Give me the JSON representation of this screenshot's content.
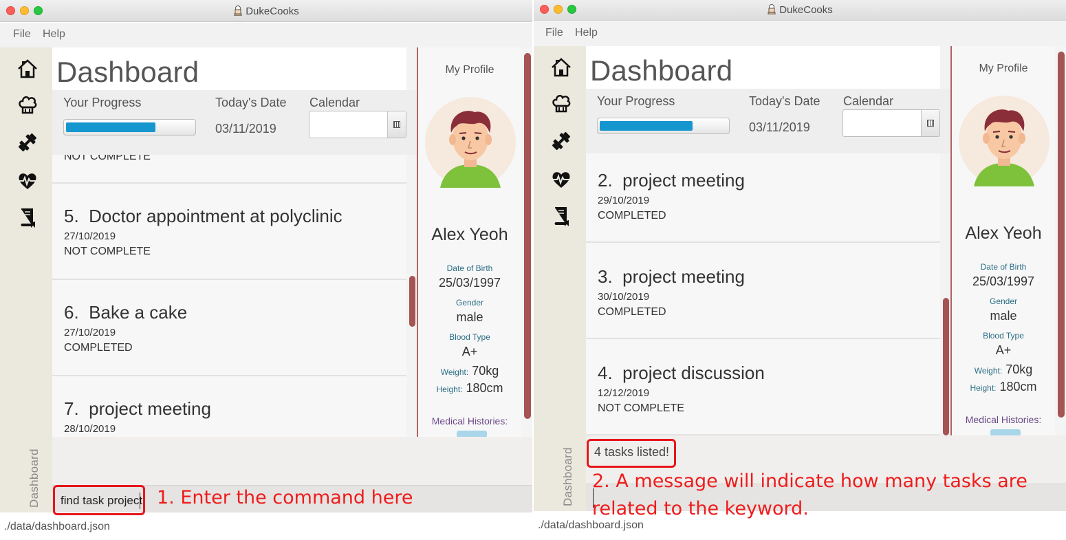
{
  "app": {
    "title": "DukeCooks"
  },
  "menu": {
    "file": "File",
    "help": "Help"
  },
  "sidebar": {
    "vertical_label": "Dashboard"
  },
  "dashboard": {
    "title": "Dashboard",
    "progress_label": "Your Progress",
    "date_label": "Today's Date",
    "calendar_label": "Calendar",
    "date_value": "03/11/2019"
  },
  "left": {
    "progress_fraction": 0.7,
    "partial_status": "NOT COMPLETE",
    "tasks": [
      {
        "index": "5.",
        "title": "Doctor appointment at polyclinic",
        "date": "27/10/2019",
        "status": "NOT COMPLETE"
      },
      {
        "index": "6.",
        "title": "Bake a cake",
        "date": "27/10/2019",
        "status": "COMPLETED"
      },
      {
        "index": "7.",
        "title": "project meeting",
        "date": "28/10/2019",
        "status": ""
      }
    ],
    "command": "find task project",
    "result": ""
  },
  "right": {
    "progress_fraction": 0.73,
    "tasks": [
      {
        "index": "2.",
        "title": "project meeting",
        "date": "29/10/2019",
        "status": "COMPLETED"
      },
      {
        "index": "3.",
        "title": "project meeting",
        "date": "30/10/2019",
        "status": "COMPLETED"
      },
      {
        "index": "4.",
        "title": "project discussion",
        "date": "12/12/2019",
        "status": "NOT COMPLETE"
      }
    ],
    "command": "",
    "result": "4 tasks listed!"
  },
  "profile": {
    "heading": "My Profile",
    "name": "Alex Yeoh",
    "dob_label": "Date of Birth",
    "dob": "25/03/1997",
    "gender_label": "Gender",
    "gender": "male",
    "blood_label": "Blood Type",
    "blood": "A+",
    "weight_label": "Weight:",
    "weight": "70kg",
    "height_label": "Height:",
    "height": "180cm",
    "medical_label": "Medical Histories:"
  },
  "status": {
    "path": "./data/dashboard.json"
  },
  "annotations": {
    "step1": "1. Enter the command here",
    "step2_line1": "2. A message will indicate how many tasks are",
    "step2_line2": "related to the keyword."
  },
  "icons": [
    "home-icon",
    "chef-hat-icon",
    "dumbbell-icon",
    "heartbeat-icon",
    "book-icon",
    "calendar-icon",
    "chef-icon"
  ],
  "colors": {
    "progress": "#1696cf",
    "scrollbar": "#a55454",
    "annotation": "#e8151b",
    "sidebar": "#ebe8dd"
  }
}
